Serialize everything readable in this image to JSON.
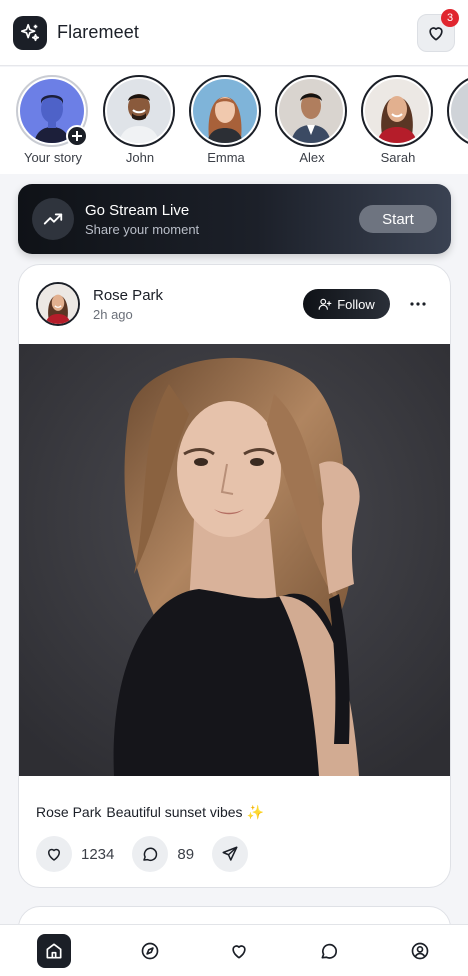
{
  "app": {
    "name": "Flaremeet",
    "notification_count": "3"
  },
  "icons": {
    "logo": "sparkles-icon",
    "notifications": "heart-icon",
    "stream": "trending-up-icon",
    "follow": "user-plus-icon",
    "more": "more-horizontal-icon",
    "like": "heart-icon",
    "comment": "message-circle-icon",
    "share": "send-icon",
    "nav": [
      "home-icon",
      "compass-icon",
      "heart-icon",
      "message-circle-icon",
      "user-circle-icon"
    ]
  },
  "stories": [
    {
      "name": "Your story",
      "own": true
    },
    {
      "name": "John"
    },
    {
      "name": "Emma"
    },
    {
      "name": "Alex"
    },
    {
      "name": "Sarah"
    }
  ],
  "stream": {
    "title": "Go Stream Live",
    "subtitle": "Share your moment",
    "button": "Start"
  },
  "post": {
    "user": "Rose Park",
    "time": "2h ago",
    "follow_label": "Follow",
    "caption_user": "Rose Park",
    "caption_text": "Beautiful sunset vibes ✨",
    "likes": "1234",
    "comments": "89"
  },
  "nav": {
    "active": "home"
  },
  "colors": {
    "accent": "#1b1f27",
    "badge": "#e0262f",
    "background": "#f4f5f8"
  }
}
